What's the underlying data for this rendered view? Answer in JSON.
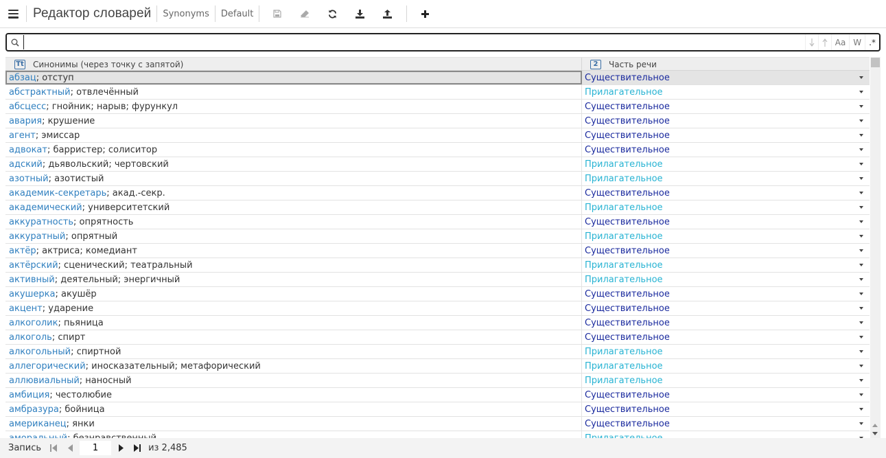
{
  "toolbar": {
    "title": "Редактор словарей",
    "dictionary": "Synonyms",
    "profile": "Default"
  },
  "search": {
    "value": "",
    "placeholder": "",
    "opt_case": "Aa",
    "opt_word": "W",
    "opt_regex": ".*"
  },
  "grid": {
    "columns": [
      {
        "label": "Синонимы (через точку с запятой)",
        "type": "Tt"
      },
      {
        "label": "Часть речи",
        "type": "2"
      }
    ],
    "rows": [
      {
        "word": "абзац",
        "rest": "; отступ",
        "pos": "Существительное",
        "kind": "noun"
      },
      {
        "word": "абстрактный",
        "rest": "; отвлечённый",
        "pos": "Прилагательное",
        "kind": "adj"
      },
      {
        "word": "абсцесс",
        "rest": "; гнойник; нарыв; фурункул",
        "pos": "Существительное",
        "kind": "noun"
      },
      {
        "word": "авария",
        "rest": "; крушение",
        "pos": "Существительное",
        "kind": "noun"
      },
      {
        "word": "агент",
        "rest": "; эмиссар",
        "pos": "Существительное",
        "kind": "noun"
      },
      {
        "word": "адвокат",
        "rest": "; барристер; солиситор",
        "pos": "Существительное",
        "kind": "noun"
      },
      {
        "word": "адский",
        "rest": "; дьявольский; чертовский",
        "pos": "Прилагательное",
        "kind": "adj"
      },
      {
        "word": "азотный",
        "rest": "; азотистый",
        "pos": "Прилагательное",
        "kind": "adj"
      },
      {
        "word": "академик-секретарь",
        "rest": "; акад.-секр.",
        "pos": "Существительное",
        "kind": "noun"
      },
      {
        "word": "академический",
        "rest": "; университетский",
        "pos": "Прилагательное",
        "kind": "adj"
      },
      {
        "word": "аккуратность",
        "rest": "; опрятность",
        "pos": "Существительное",
        "kind": "noun"
      },
      {
        "word": "аккуратный",
        "rest": "; опрятный",
        "pos": "Прилагательное",
        "kind": "adj"
      },
      {
        "word": "актёр",
        "rest": "; актриса; комедиант",
        "pos": "Существительное",
        "kind": "noun"
      },
      {
        "word": "актёрский",
        "rest": "; сценический; театральный",
        "pos": "Прилагательное",
        "kind": "adj"
      },
      {
        "word": "активный",
        "rest": "; деятельный; энергичный",
        "pos": "Прилагательное",
        "kind": "adj"
      },
      {
        "word": "акушерка",
        "rest": "; акушёр",
        "pos": "Существительное",
        "kind": "noun"
      },
      {
        "word": "акцент",
        "rest": "; ударение",
        "pos": "Существительное",
        "kind": "noun"
      },
      {
        "word": "алкоголик",
        "rest": "; пьяница",
        "pos": "Существительное",
        "kind": "noun"
      },
      {
        "word": "алкоголь",
        "rest": "; спирт",
        "pos": "Существительное",
        "kind": "noun"
      },
      {
        "word": "алкогольный",
        "rest": "; спиртной",
        "pos": "Прилагательное",
        "kind": "adj"
      },
      {
        "word": "аллегорический",
        "rest": "; иносказательный; метафорический",
        "pos": "Прилагательное",
        "kind": "adj"
      },
      {
        "word": "аллювиальный",
        "rest": "; наносный",
        "pos": "Прилагательное",
        "kind": "adj"
      },
      {
        "word": "амбиция",
        "rest": "; честолюбие",
        "pos": "Существительное",
        "kind": "noun"
      },
      {
        "word": "амбразура",
        "rest": "; бойница",
        "pos": "Существительное",
        "kind": "noun"
      },
      {
        "word": "американец",
        "rest": "; янки",
        "pos": "Существительное",
        "kind": "noun"
      },
      {
        "word": "аморальный",
        "rest": "; безнравственный",
        "pos": "Прилагательное",
        "kind": "adj"
      }
    ]
  },
  "footer": {
    "record_label": "Запись",
    "current_record": "1",
    "total_label": "из 2,485"
  },
  "colors": {
    "word": "#2f7fbf",
    "noun": "#1a2a9e",
    "adjective": "#27b3d3"
  },
  "icons": [
    "menu-icon",
    "save-icon",
    "eraser-icon",
    "refresh-icon",
    "download-icon",
    "upload-icon",
    "plus-icon",
    "search-icon",
    "arrow-down-icon",
    "arrow-up-icon",
    "dropdown-arrow-icon",
    "first-page-icon",
    "prev-page-icon",
    "next-page-icon",
    "last-page-icon"
  ]
}
